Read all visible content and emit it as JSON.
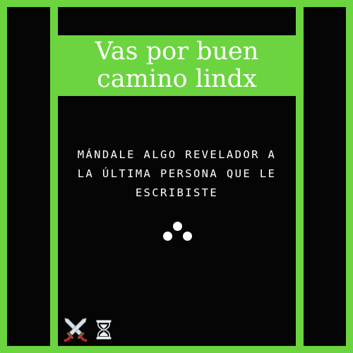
{
  "banner": {
    "title": "Vas por buen camino lindx"
  },
  "prompt": {
    "text": "MÁNDALE ALGO REVELADOR A LA ÚLTIMA PERSONA QUE LE ESCRIBISTE"
  },
  "icons": {
    "swords": "crossed-swords-icon",
    "hourglass": "hourglass-icon"
  },
  "colors": {
    "accent": "#6bd43f",
    "background": "#050505",
    "text": "#ffffff"
  }
}
